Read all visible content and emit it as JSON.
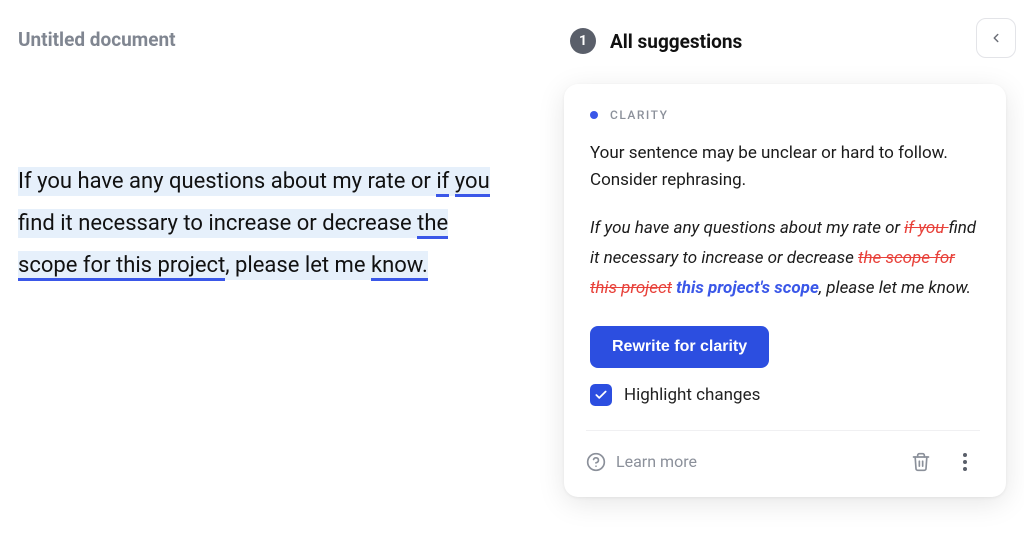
{
  "document": {
    "title": "Untitled document",
    "body": {
      "part1": "If you have any questions about my rate or ",
      "u1a": "if",
      "part2": " ",
      "u1b": "you",
      "part3": " find it necessary to increase or decrease ",
      "u2": "the scope for this project",
      "part4": ", please let me ",
      "u3": "know.",
      "part5": ""
    }
  },
  "panel": {
    "count": "1",
    "header": "All suggestions"
  },
  "card": {
    "category": "CLARITY",
    "explanation": "Your sentence may be unclear or hard to follow. Consider rephrasing.",
    "rewrite": {
      "p1": "If you have any questions about my rate or ",
      "strike1": "if you ",
      "p2": "find it necessary to increase or decrease ",
      "strike2": "the scope for this project",
      "space": " ",
      "insert1": "this project's scope",
      "p3": ", please let me know."
    },
    "button": "Rewrite for clarity",
    "checkbox_label": "Highlight changes",
    "learn_more": "Learn more"
  },
  "colors": {
    "accent": "#2c4ee0",
    "remove": "#e8413a"
  }
}
